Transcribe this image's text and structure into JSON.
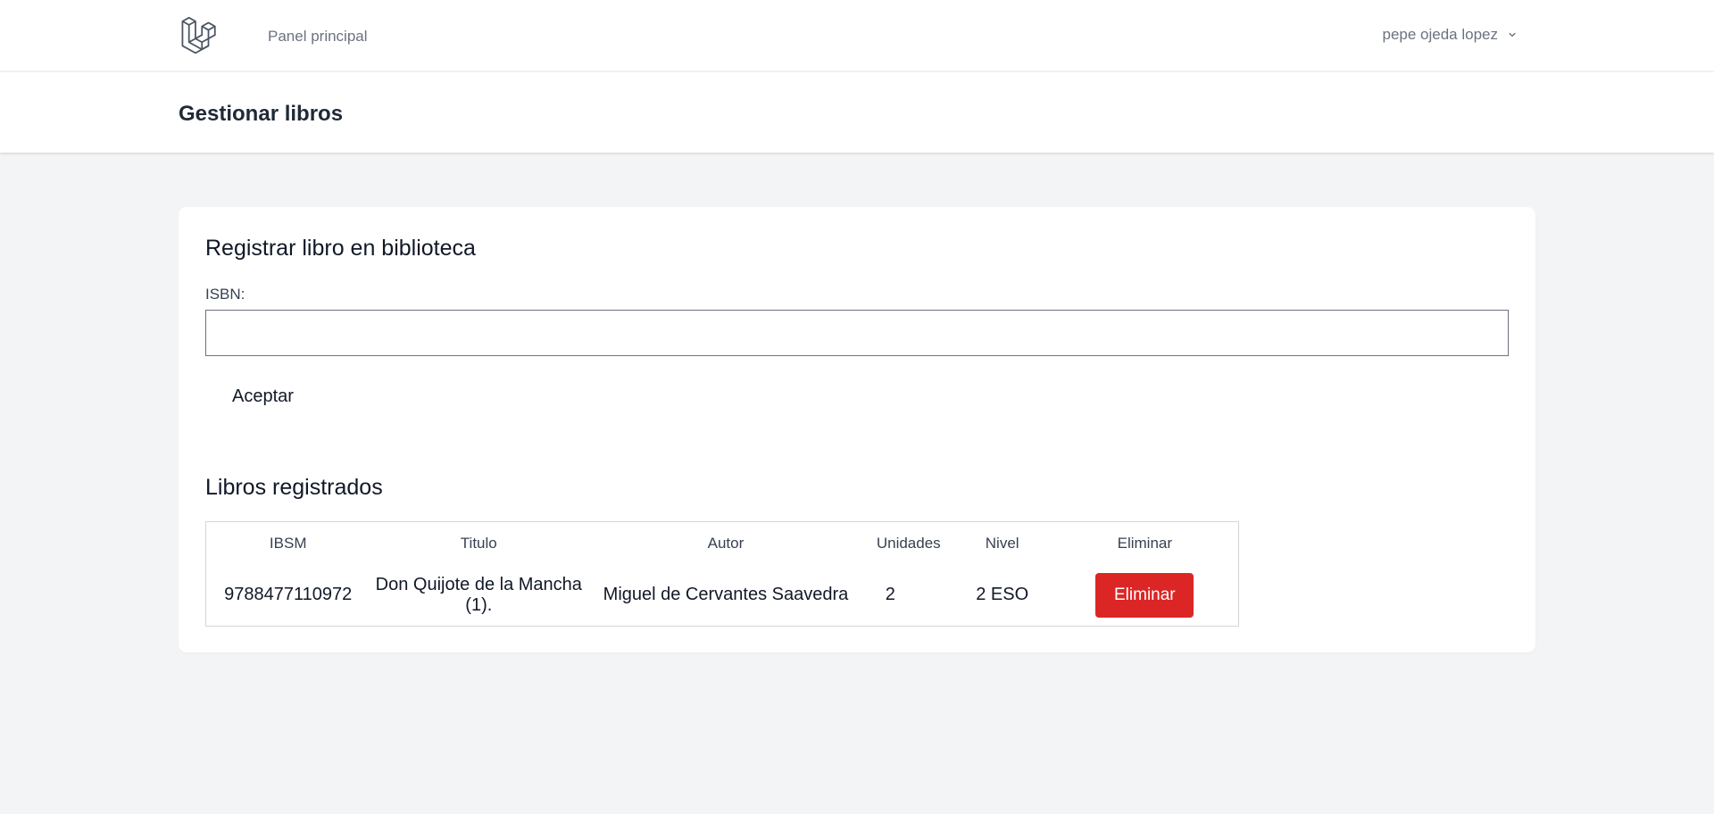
{
  "nav": {
    "logo_icon": "laravel-logo-icon",
    "dashboard_link": "Panel principal",
    "user_name": "pepe ojeda lopez",
    "user_menu_icon": "chevron-down-icon"
  },
  "header": {
    "title": "Gestionar libros"
  },
  "register": {
    "heading": "Registrar libro en biblioteca",
    "isbn_label": "ISBN:",
    "isbn_value": "",
    "accept_label": "Aceptar"
  },
  "books": {
    "heading": "Libros registrados",
    "columns": [
      "IBSM",
      "Titulo",
      "Autor",
      "Unidades",
      "Nivel",
      "Eliminar"
    ],
    "rows": [
      {
        "isbn": "9788477110972",
        "title": "Don Quijote de la Mancha (1).",
        "author": "Miguel de Cervantes Saavedra",
        "units": "2",
        "level": "2 ESO",
        "delete_label": "Eliminar"
      }
    ]
  },
  "colors": {
    "accent_danger": "#dc2626",
    "page_bg": "#f3f4f6",
    "card_bg": "#ffffff"
  }
}
